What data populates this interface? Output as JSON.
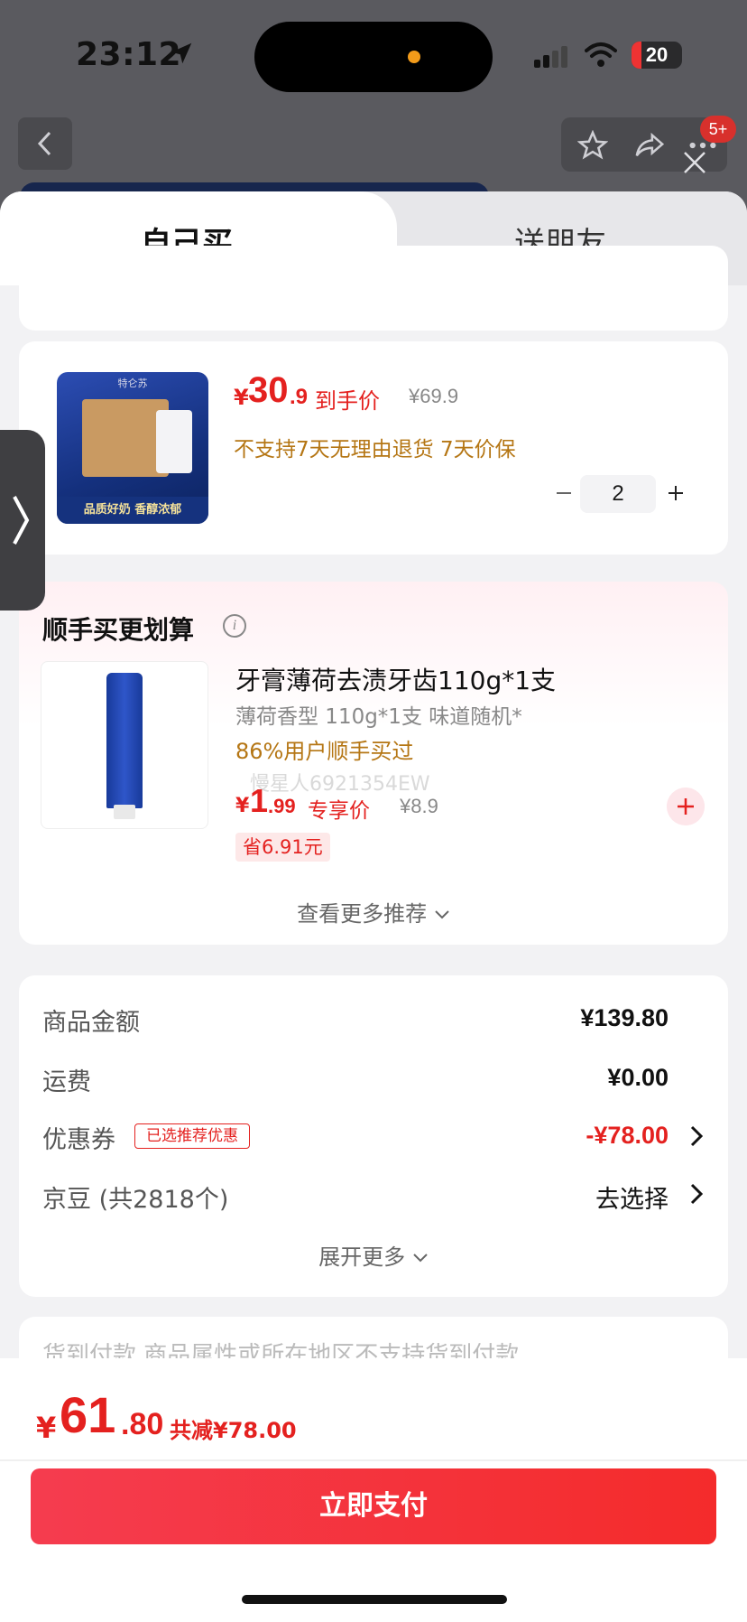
{
  "status_bar": {
    "time": "23:12",
    "battery": "20",
    "battery_level_pct": 20
  },
  "background": {
    "badge": "5+"
  },
  "tabs": [
    {
      "label": "自己买"
    },
    {
      "label": "送朋友"
    }
  ],
  "product": {
    "price_symbol": "¥",
    "price_int": "30",
    "price_dec": ".9",
    "price_label": "到手价",
    "original_price": "¥69.9",
    "tags": "不支持7天无理由退货  7天价保",
    "quantity": "2",
    "image_top_text": "特仑苏",
    "image_banner": "品质好奶 香醇浓郁"
  },
  "recommend": {
    "title": "顺手买更划算",
    "item": {
      "name": "牙膏薄荷去渍牙齿110g*1支",
      "spec": "薄荷香型 110g*1支 味道随机*",
      "bought": "86%用户顺手买过",
      "watermark": "慢星人6921354EW",
      "price_symbol": "¥",
      "price_int": "1",
      "price_dec": ".99",
      "price_label": "专享价",
      "original_price": "¥8.9",
      "save": "省6.91元"
    },
    "more": "查看更多推荐"
  },
  "summary": {
    "goods_label": "商品金额",
    "goods_value": "¥139.80",
    "shipping_label": "运费",
    "shipping_value": "¥0.00",
    "coupon_label": "优惠券",
    "coupon_tag": "已选推荐优惠",
    "coupon_value": "-¥78.00",
    "jd_bean_label": "京豆 (共2818个)",
    "jd_bean_value": "去选择",
    "expand": "展开更多"
  },
  "cod": {
    "text": "货到付款    商品属性或所在地区不支持货到付款"
  },
  "bottom": {
    "price_symbol": "¥",
    "price_int": "61",
    "price_dec": ".80",
    "reduce": "共减¥78.00",
    "pay_label": "立即支付"
  },
  "colors": {
    "accent": "#e4211f",
    "gold": "#b57614"
  }
}
